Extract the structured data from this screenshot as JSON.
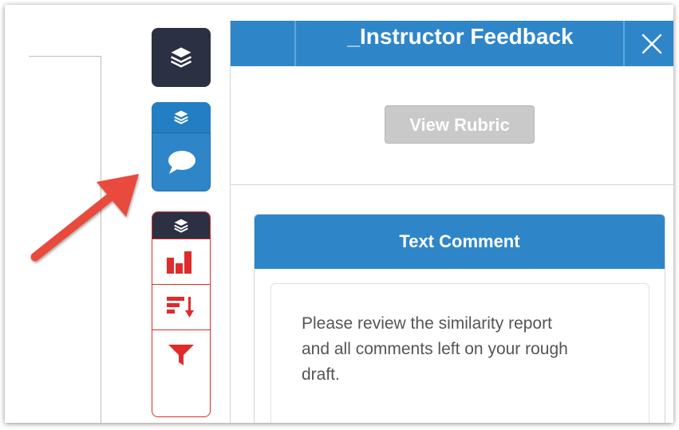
{
  "panel": {
    "title": "_Instructor Feedback",
    "close_icon": "close-icon",
    "view_rubric_label": "View Rubric"
  },
  "toolbar": {
    "layers_icon": "layers-icon",
    "comment_icon": "comment-bubble-icon",
    "chart_icon": "bar-chart-icon",
    "sort_icon": "sort-icon",
    "filter_icon": "filter-icon"
  },
  "comment_card": {
    "heading": "Text Comment",
    "text_lines": [
      "Please review the similarity report",
      "and all comments left on your rough",
      "draft."
    ]
  },
  "colors": {
    "accent_blue": "#2e86c9",
    "dark_navy": "#2b3042",
    "tool_red": "#e02b2b",
    "arrow_red": "#e84c3d",
    "disabled_gray": "#c9c9c9"
  }
}
